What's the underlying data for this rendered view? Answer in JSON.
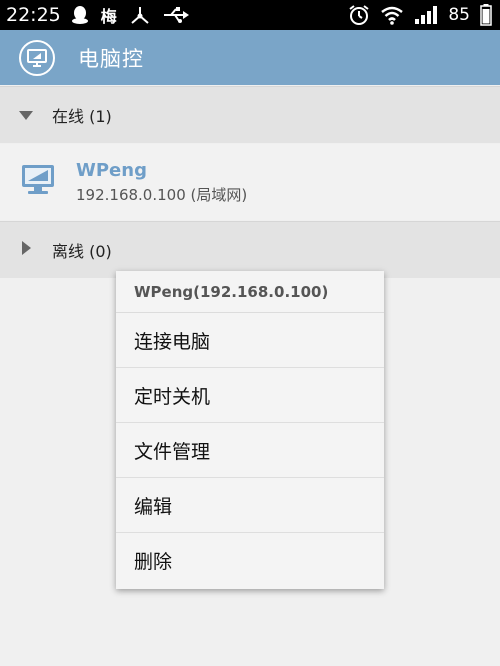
{
  "status_bar": {
    "time": "22:25",
    "battery": "85",
    "icons": [
      "qq-icon",
      "meizu-icon",
      "network-icon",
      "usb-icon",
      "alarm-icon",
      "wifi-icon",
      "signal-icon",
      "battery-icon"
    ],
    "meizu_text": "梅"
  },
  "header": {
    "title": "电脑控",
    "accent_color": "#7aa5c8"
  },
  "groups": {
    "online": {
      "label": "在线 (1)"
    },
    "offline": {
      "label": "离线 (0)"
    }
  },
  "devices": [
    {
      "name": "WPeng",
      "ip": "192.168.0.100 (局域网)"
    }
  ],
  "context_menu": {
    "title": "WPeng(192.168.0.100)",
    "items": [
      "连接电脑",
      "定时关机",
      "文件管理",
      "编辑",
      "删除"
    ]
  }
}
